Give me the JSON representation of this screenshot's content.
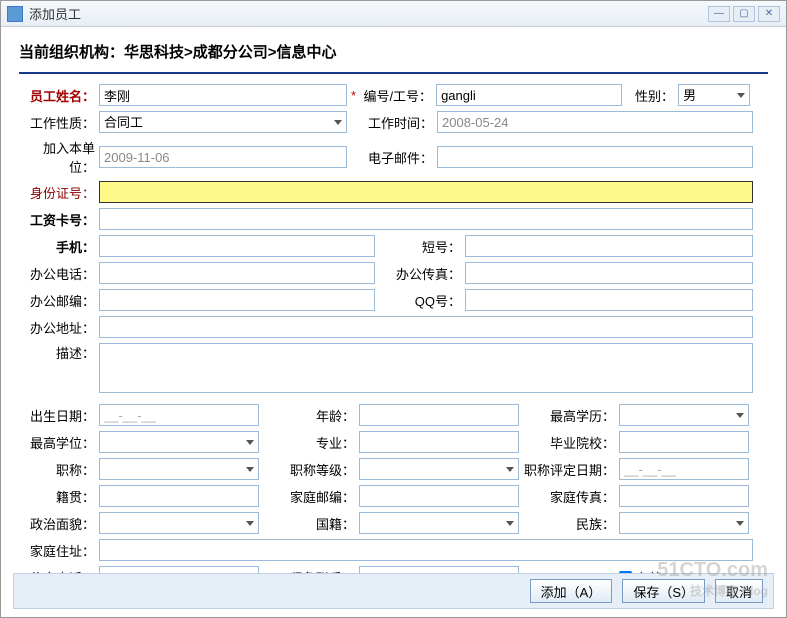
{
  "window": {
    "title": "添加员工"
  },
  "breadcrumb": {
    "prefix": "当前组织机构：",
    "path": "华思科技>成都分公司>信息中心"
  },
  "labels": {
    "name": "员工姓名：",
    "code": "编号/工号：",
    "gender": "性别：",
    "workType": "工作性质：",
    "workTime": "工作时间：",
    "joinDate": "加入本单位：",
    "email": "电子邮件：",
    "idCard": "身份证号：",
    "salaryCard": "工资卡号：",
    "mobile": "手机：",
    "shortNo": "短号：",
    "officeTel": "办公电话：",
    "officeFax": "办公传真：",
    "officePost": "办公邮编：",
    "qq": "QQ号：",
    "officeAddr": "办公地址：",
    "desc": "描述：",
    "birth": "出生日期：",
    "age": "年龄：",
    "topEdu": "最高学历：",
    "topDegree": "最高学位：",
    "major": "专业：",
    "gradSchool": "毕业院校：",
    "title": "职称：",
    "titleLevel": "职称等级：",
    "titleDate": "职称评定日期：",
    "native": "籍贯：",
    "homePost": "家庭邮编：",
    "homeFax": "家庭传真：",
    "politics": "政治面貌：",
    "nation": "国籍：",
    "ethnic": "民族：",
    "homeAddr": "家庭住址：",
    "homeTel": "住宅电话：",
    "emergency": "紧急联系：",
    "valid": "有效"
  },
  "values": {
    "name": "李刚",
    "code": "gangli",
    "gender": "男",
    "workType": "合同工",
    "workTime": "2008-05-24",
    "joinDate": "2009-11-06",
    "email": "",
    "idCard": "",
    "salaryCard": "",
    "mobile": "",
    "shortNo": "",
    "officeTel": "",
    "officeFax": "",
    "officePost": "",
    "qq": "",
    "officeAddr": "",
    "desc": "",
    "birth": "__-__-__",
    "age": "",
    "topEdu": "",
    "topDegree": "",
    "major": "",
    "gradSchool": "",
    "title": "",
    "titleLevel": "",
    "titleDate": "__-__-__",
    "native": "",
    "homePost": "",
    "homeFax": "",
    "politics": "",
    "nation": "",
    "ethnic": "",
    "homeAddr": "",
    "homeTel": "",
    "emergency": ""
  },
  "buttons": {
    "add": "添加（A）",
    "save": "保存（S）",
    "cancel": "取消"
  },
  "watermark": {
    "main": "51CTO.com",
    "sub": "技术博客 Blog"
  }
}
